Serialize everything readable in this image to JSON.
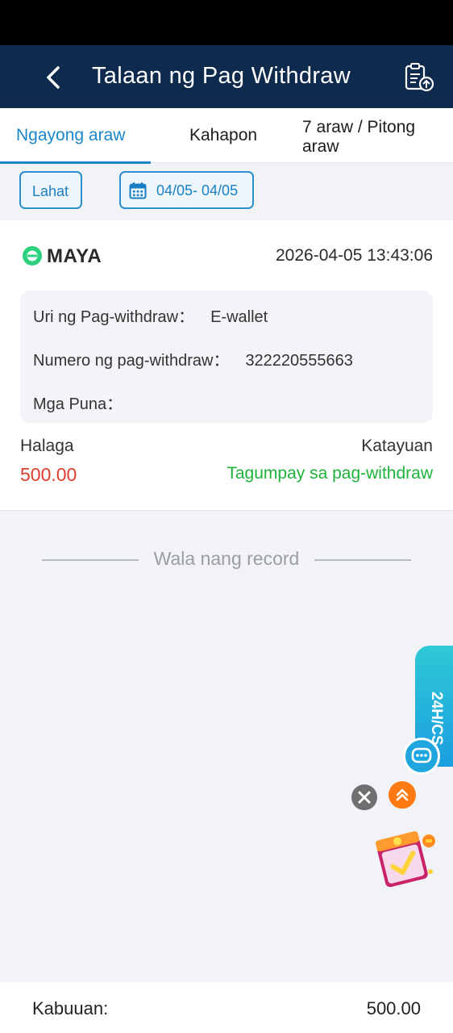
{
  "header": {
    "title": "Talaan ng Pag Withdraw",
    "back_icon": "chevron-left-icon",
    "action_icon": "clipboard-upload-icon"
  },
  "tabs": [
    {
      "label": "Ngayong araw",
      "active": true
    },
    {
      "label": "Kahapon",
      "active": false
    },
    {
      "label": "7 araw / Pitong araw",
      "active": false
    }
  ],
  "filters": {
    "all_label": "Lahat",
    "date_range": "04/05- 04/05",
    "date_icon": "calendar-icon"
  },
  "record": {
    "provider": "MAYA",
    "timestamp": "2026-04-05 13:43:06",
    "type_label": "Uri ng Pag-withdraw：",
    "type_value": "E-wallet",
    "number_label": "Numero ng pag-withdraw：",
    "number_value": "322220555663",
    "remarks_label": "Mga Puna：",
    "amount_label": "Halaga",
    "amount_value": "500.00",
    "status_label": "Katayuan",
    "status_value": "Tagumpay sa pag-withdraw"
  },
  "list_end_text": "Wala nang record",
  "floating": {
    "cs_label": "24H/CS"
  },
  "footer": {
    "total_label": "Kabuuan:",
    "total_value": "500.00"
  },
  "colors": {
    "header_bg": "#0e2a4d",
    "accent": "#1a86c7",
    "amount": "#d9402b",
    "success": "#1db33a"
  }
}
